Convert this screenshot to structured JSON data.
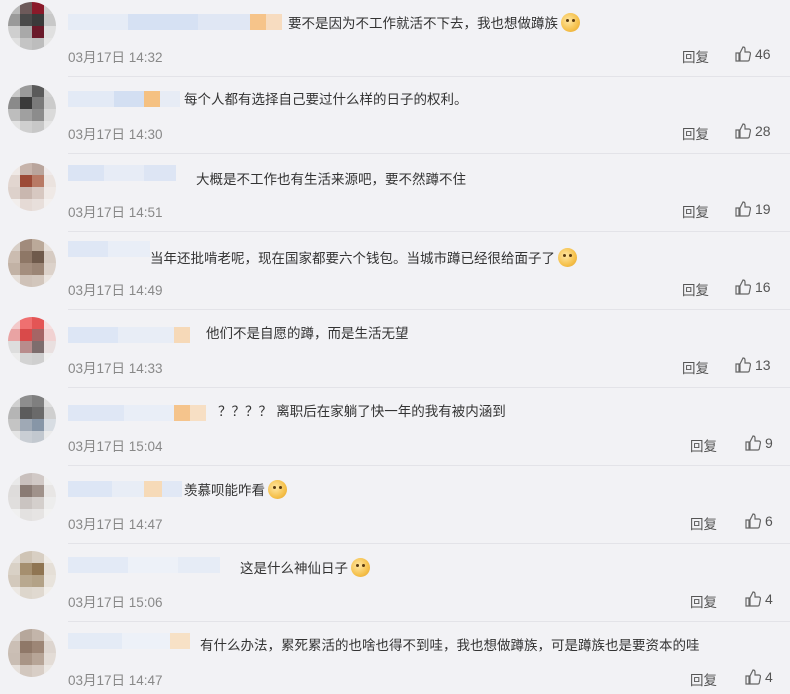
{
  "reply_label": "回复",
  "comments": [
    {
      "text": "要不是因为不工作就活不下去，我也想做蹲族",
      "emoji": "doge-emoji",
      "time": "03月17日 14:32",
      "likes": "46"
    },
    {
      "text": "每个人都有选择自己要过什么样的日子的权利。",
      "emoji": null,
      "time": "03月17日 14:30",
      "likes": "28"
    },
    {
      "text": "大概是不工作也有生活来源吧，要不然蹲不住",
      "emoji": null,
      "time": "03月17日 14:51",
      "likes": "19"
    },
    {
      "text": "当年还批啃老呢，现在国家都要六个钱包。当城市蹲已经很给面子了",
      "emoji": "yum-emoji",
      "time": "03月17日 14:49",
      "likes": "16"
    },
    {
      "text": "他们不是自愿的蹲，而是生活无望",
      "emoji": null,
      "time": "03月17日 14:33",
      "likes": "13"
    },
    {
      "text": "？？？？ 离职后在家躺了快一年的我有被内涵到",
      "emoji": null,
      "time": "03月17日 15:04",
      "likes": "9"
    },
    {
      "text": "羡慕呗能咋看",
      "emoji": "doge-emoji",
      "time": "03月17日 14:47",
      "likes": "6"
    },
    {
      "text": "这是什么神仙日子",
      "emoji": "doge-emoji",
      "time": "03月17日 15:06",
      "likes": "4"
    },
    {
      "text": "有什么办法，累死累活的也啥也得不到哇，我也想做蹲族，可是蹲族也是要资本的哇",
      "emoji": null,
      "time": "03月17日 14:47",
      "likes": "4"
    }
  ]
}
